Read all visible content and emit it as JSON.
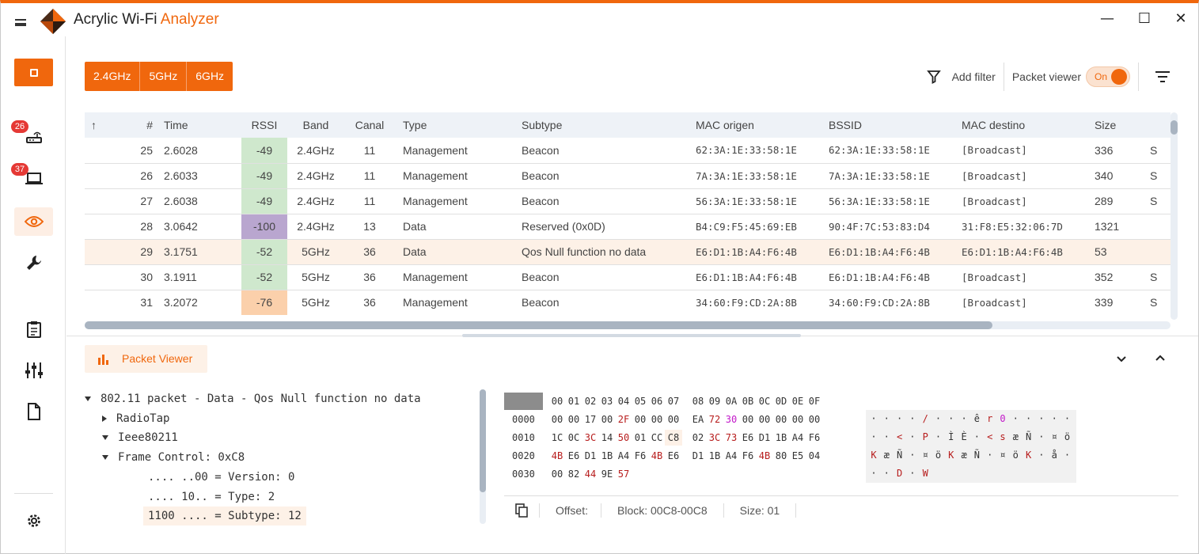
{
  "app": {
    "title_main": "Acrylic Wi-Fi ",
    "title_accent": "Analyzer",
    "accent_color": "#f0670d"
  },
  "window": {
    "minimize_icon": "minimize-icon",
    "maximize_icon": "maximize-icon",
    "close_icon": "close-icon"
  },
  "sidebar": {
    "items": [
      {
        "name": "access-points",
        "icon": "router-icon",
        "badge": "26"
      },
      {
        "name": "stations",
        "icon": "laptop-icon",
        "badge": "37"
      },
      {
        "name": "packet-viewer",
        "icon": "eye-icon",
        "active": true
      },
      {
        "name": "tools",
        "icon": "wrench-icon"
      },
      {
        "name": "reports",
        "icon": "clipboard-icon"
      },
      {
        "name": "equalizer",
        "icon": "sliders-icon"
      },
      {
        "name": "document",
        "icon": "document-icon"
      },
      {
        "name": "settings",
        "icon": "gear-icon"
      }
    ]
  },
  "toolbar": {
    "bands": [
      "2.4GHz",
      "5GHz",
      "6GHz"
    ],
    "add_filter": "Add filter",
    "packet_viewer_label": "Packet viewer",
    "toggle_state": "On"
  },
  "table": {
    "columns": [
      "#",
      "Time",
      "RSSI",
      "Band",
      "Canal",
      "Type",
      "Subtype",
      "MAC origen",
      "BSSID",
      "MAC destino",
      "Size"
    ],
    "rows": [
      {
        "n": "25",
        "time": "2.6028",
        "rssi": "-49",
        "rssi_color": "#cfe8cd",
        "band": "2.4GHz",
        "canal": "11",
        "type": "Management",
        "subtype": "Beacon",
        "src": "62:3A:1E:33:58:1E",
        "bssid": "62:3A:1E:33:58:1E",
        "dst": "[Broadcast]",
        "size": "336",
        "extra": "S"
      },
      {
        "n": "26",
        "time": "2.6033",
        "rssi": "-49",
        "rssi_color": "#cfe8cd",
        "band": "2.4GHz",
        "canal": "11",
        "type": "Management",
        "subtype": "Beacon",
        "src": "7A:3A:1E:33:58:1E",
        "bssid": "7A:3A:1E:33:58:1E",
        "dst": "[Broadcast]",
        "size": "340",
        "extra": "S"
      },
      {
        "n": "27",
        "time": "2.6038",
        "rssi": "-49",
        "rssi_color": "#cfe8cd",
        "band": "2.4GHz",
        "canal": "11",
        "type": "Management",
        "subtype": "Beacon",
        "src": "56:3A:1E:33:58:1E",
        "bssid": "56:3A:1E:33:58:1E",
        "dst": "[Broadcast]",
        "size": "289",
        "extra": "S"
      },
      {
        "n": "28",
        "time": "3.0642",
        "rssi": "-100",
        "rssi_color": "#b9a6cf",
        "band": "2.4GHz",
        "canal": "13",
        "type": "Data",
        "subtype": "Reserved (0x0D)",
        "src": "B4:C9:F5:45:69:EB",
        "bssid": "90:4F:7C:53:83:D4",
        "dst": "31:F8:E5:32:06:7D",
        "size": "1321",
        "extra": ""
      },
      {
        "n": "29",
        "time": "3.1751",
        "rssi": "-52",
        "rssi_color": "#cfe8cd",
        "band": "5GHz",
        "canal": "36",
        "type": "Data",
        "subtype": "Qos Null function no data",
        "src": "E6:D1:1B:A4:F6:4B",
        "bssid": "E6:D1:1B:A4:F6:4B",
        "dst": "E6:D1:1B:A4:F6:4B",
        "size": "53",
        "extra": "",
        "selected": true
      },
      {
        "n": "30",
        "time": "3.1911",
        "rssi": "-52",
        "rssi_color": "#cfe8cd",
        "band": "5GHz",
        "canal": "36",
        "type": "Management",
        "subtype": "Beacon",
        "src": "E6:D1:1B:A4:F6:4B",
        "bssid": "E6:D1:1B:A4:F6:4B",
        "dst": "[Broadcast]",
        "size": "352",
        "extra": "S"
      },
      {
        "n": "31",
        "time": "3.2072",
        "rssi": "-76",
        "rssi_color": "#fbd0ab",
        "band": "5GHz",
        "canal": "36",
        "type": "Management",
        "subtype": "Beacon",
        "src": "34:60:F9:CD:2A:8B",
        "bssid": "34:60:F9:CD:2A:8B",
        "dst": "[Broadcast]",
        "size": "339",
        "extra": "S"
      }
    ]
  },
  "packet_viewer": {
    "tab_label": "Packet Viewer",
    "tree": [
      {
        "text": "802.11 packet - Data - Qos Null function no data",
        "level": 0,
        "arrow": "down"
      },
      {
        "text": "RadioTap",
        "level": 1,
        "arrow": "right"
      },
      {
        "text": "Ieee80211",
        "level": 1,
        "arrow": "down"
      },
      {
        "text": "Frame Control: 0xC8",
        "level": 2,
        "arrow": "down"
      },
      {
        "text": ".... ..00 = Version: 0",
        "level": 3,
        "arrow": ""
      },
      {
        "text": ".... 10.. = Type: 2",
        "level": 3,
        "arrow": ""
      },
      {
        "text": "1100 .... = Subtype: 12",
        "level": 3,
        "arrow": "",
        "highlight": true
      }
    ],
    "hex_header": [
      "00",
      "01",
      "02",
      "03",
      "04",
      "05",
      "06",
      "07",
      "08",
      "09",
      "0A",
      "0B",
      "0C",
      "0D",
      "0E",
      "0F"
    ],
    "hex_rows": [
      {
        "offset": "0000",
        "bytes": [
          "00",
          "00",
          "17",
          "00",
          "2F",
          "00",
          "00",
          "00",
          "EA",
          "72",
          "30",
          "00",
          "00",
          "00",
          "00",
          "00"
        ],
        "colors": [
          "",
          "",
          "",
          "",
          "r",
          "",
          "",
          "",
          "",
          "r",
          "m",
          "",
          "",
          "",
          "",
          ""
        ],
        "ascii": [
          "·",
          "·",
          "·",
          "·",
          "/",
          "·",
          "·",
          "·",
          "ê",
          "r",
          "0",
          "·",
          "·",
          "·",
          "·",
          "·"
        ],
        "ascii_colors": [
          "",
          "",
          "",
          "",
          "r",
          "",
          "",
          "",
          "",
          "r",
          "m",
          "",
          "",
          "",
          "",
          ""
        ]
      },
      {
        "offset": "0010",
        "bytes": [
          "1C",
          "0C",
          "3C",
          "14",
          "50",
          "01",
          "CC",
          "C8",
          "02",
          "3C",
          "73",
          "E6",
          "D1",
          "1B",
          "A4",
          "F6"
        ],
        "colors": [
          "",
          "",
          "r",
          "",
          "r",
          "",
          "",
          "",
          "",
          "r",
          "r",
          "",
          "",
          "",
          "",
          ""
        ],
        "ascii": [
          "·",
          "·",
          "<",
          "·",
          "P",
          "·",
          "Ì",
          "È",
          "·",
          "<",
          "s",
          "æ",
          "Ñ",
          "·",
          "¤",
          "ö"
        ],
        "ascii_colors": [
          "",
          "",
          "r",
          "",
          "r",
          "",
          "",
          "",
          "",
          "r",
          "r",
          "",
          "",
          "",
          "",
          ""
        ]
      },
      {
        "offset": "0020",
        "bytes": [
          "4B",
          "E6",
          "D1",
          "1B",
          "A4",
          "F6",
          "4B",
          "E6",
          "D1",
          "1B",
          "A4",
          "F6",
          "4B",
          "80",
          "E5",
          "04"
        ],
        "colors": [
          "r",
          "",
          "",
          "",
          "",
          "",
          "r",
          "",
          "",
          "",
          "",
          "",
          "r",
          "",
          "",
          ""
        ],
        "ascii": [
          "K",
          "æ",
          "Ñ",
          "·",
          "¤",
          "ö",
          "K",
          "æ",
          "Ñ",
          "·",
          "¤",
          "ö",
          "K",
          "·",
          "å",
          "·"
        ],
        "ascii_colors": [
          "r",
          "",
          "",
          "",
          "",
          "",
          "r",
          "",
          "",
          "",
          "",
          "",
          "r",
          "",
          "",
          ""
        ]
      },
      {
        "offset": "0030",
        "bytes": [
          "00",
          "82",
          "44",
          "9E",
          "57"
        ],
        "colors": [
          "",
          "",
          "r",
          "",
          "r"
        ],
        "ascii": [
          "·",
          "·",
          "D",
          "·",
          "W"
        ],
        "ascii_colors": [
          "",
          "",
          "r",
          "",
          "r"
        ]
      }
    ],
    "highlight_byte": {
      "row": 1,
      "col": 7
    },
    "status": {
      "offset": "Offset:",
      "block": "Block: 00C8-00C8",
      "size": "Size: 01"
    }
  }
}
